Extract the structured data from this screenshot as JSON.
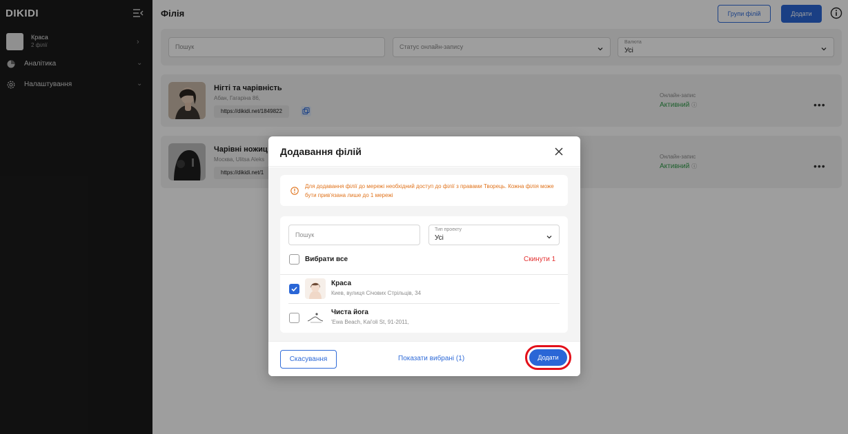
{
  "sidebar": {
    "brand": "DIKIDI",
    "org": {
      "name": "Краса",
      "sub": "2 філії"
    },
    "items": [
      {
        "label": "Аналітика",
        "icon": "pie-chart-icon"
      },
      {
        "label": "Налаштування",
        "icon": "gear-icon"
      }
    ]
  },
  "header": {
    "title": "Філія",
    "groups_label": "Групи філій",
    "add_label": "Додати"
  },
  "filters": {
    "search_placeholder": "Пошук",
    "status_placeholder": "Статус онлайн-запису",
    "currency_label": "Валюта",
    "currency_value": "Усі"
  },
  "branches": [
    {
      "name": "Нігті та чарівність",
      "address": "Абан, Гагаріна 86,",
      "link": "https://dikidi.net/1849822",
      "online_label": "Онлайн-запис",
      "status": "Активний"
    },
    {
      "name": "Чарівні ножиц",
      "address": "Москва, Ulitsa Aleks",
      "link": "https://dikidi.net/1",
      "online_label": "Онлайн-запис",
      "status": "Активний"
    }
  ],
  "modal": {
    "title": "Додавання філій",
    "alert": "Для додавання філії до мережі необхідний доступ до філії з правами Творець. Кожна філія може бути прив'язана лише до 1 мережі",
    "search_placeholder": "Пошук",
    "type_label": "Тип проекту",
    "type_value": "Усі",
    "select_all": "Вибрати все",
    "reset": "Скинути 1",
    "items": [
      {
        "name": "Краса",
        "address": "Киев, вулиця Січових Стрільців, 34",
        "checked": true
      },
      {
        "name": "Чиста йога",
        "address": "'Ewa Beach, Kai'oli St, 91-2011,",
        "checked": false
      }
    ],
    "cancel": "Скасування",
    "show_selected": "Показати вибрані (1)",
    "add": "Додати"
  },
  "colors": {
    "accent": "#2a66d6",
    "active": "#2f9a48",
    "warning": "#e0731c",
    "danger": "#e33030",
    "highlight": "#e3101a"
  }
}
